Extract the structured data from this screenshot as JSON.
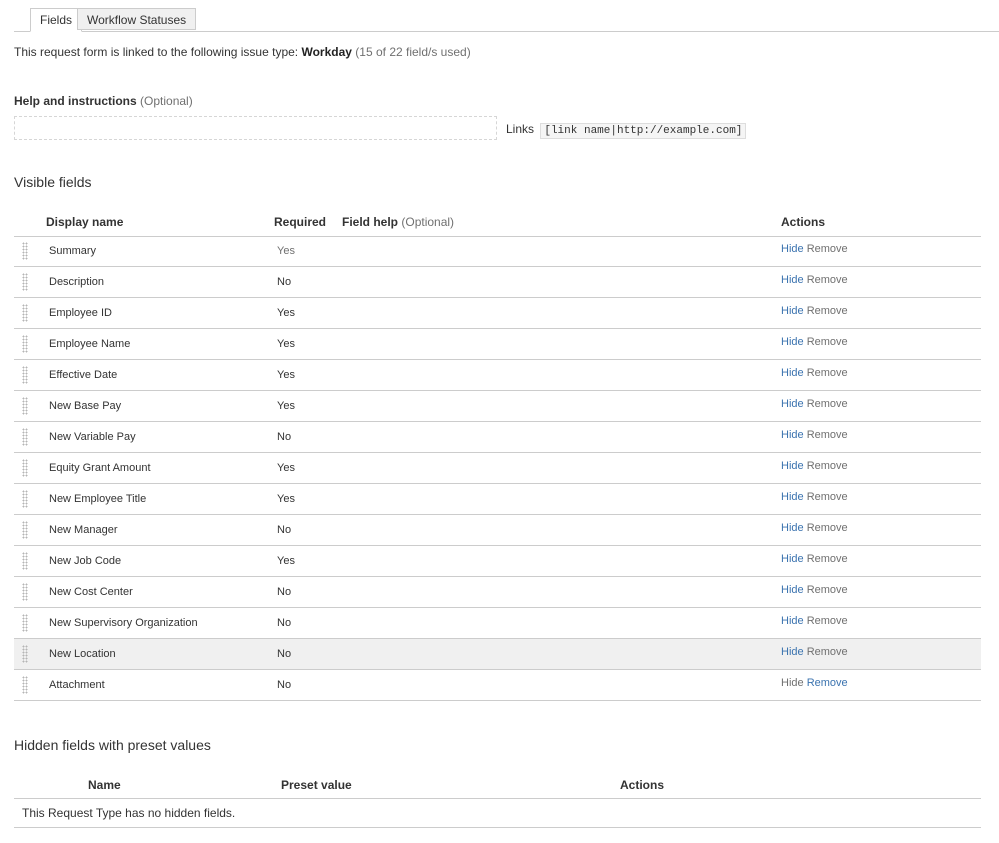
{
  "tabs": [
    {
      "label": "Fields",
      "active": true
    },
    {
      "label": "Workflow Statuses",
      "active": false
    }
  ],
  "linked": {
    "prefix": "This request form is linked to the following issue type:",
    "issue_type": "Workday",
    "usage": "(15 of 22 field/s used)"
  },
  "help": {
    "label": "Help and instructions",
    "optional": "(Optional)",
    "value": "",
    "links_label": "Links",
    "links_example": "[link name|http://example.com]"
  },
  "visible_fields": {
    "title": "Visible fields",
    "headers": {
      "display_name": "Display name",
      "required": "Required",
      "field_help": "Field help",
      "field_help_optional": "(Optional)",
      "actions": "Actions"
    },
    "action_labels": {
      "hide": "Hide",
      "remove": "Remove"
    },
    "rows": [
      {
        "name": "Summary",
        "required": "Yes"
      },
      {
        "name": "Description",
        "required": "No"
      },
      {
        "name": "Employee ID",
        "required": "Yes"
      },
      {
        "name": "Employee Name",
        "required": "Yes"
      },
      {
        "name": "Effective Date",
        "required": "Yes"
      },
      {
        "name": "New Base Pay",
        "required": "Yes"
      },
      {
        "name": "New Variable Pay",
        "required": "No"
      },
      {
        "name": "Equity Grant Amount",
        "required": "Yes"
      },
      {
        "name": "New Employee Title",
        "required": "Yes"
      },
      {
        "name": "New Manager",
        "required": "No"
      },
      {
        "name": "New Job Code",
        "required": "Yes"
      },
      {
        "name": "New Cost Center",
        "required": "No"
      },
      {
        "name": "New Supervisory Organization",
        "required": "No"
      },
      {
        "name": "New Location",
        "required": "No",
        "highlighted": true
      },
      {
        "name": "Attachment",
        "required": "No"
      }
    ]
  },
  "hidden_fields": {
    "title": "Hidden fields with preset values",
    "headers": {
      "name": "Name",
      "preset_value": "Preset value",
      "actions": "Actions"
    },
    "empty_message": "This Request Type has no hidden fields."
  },
  "colors": {
    "link_blue": "#3b73af",
    "muted_grey": "#707070",
    "row_highlight": "#f0f0f0",
    "border": "#cccccc"
  }
}
